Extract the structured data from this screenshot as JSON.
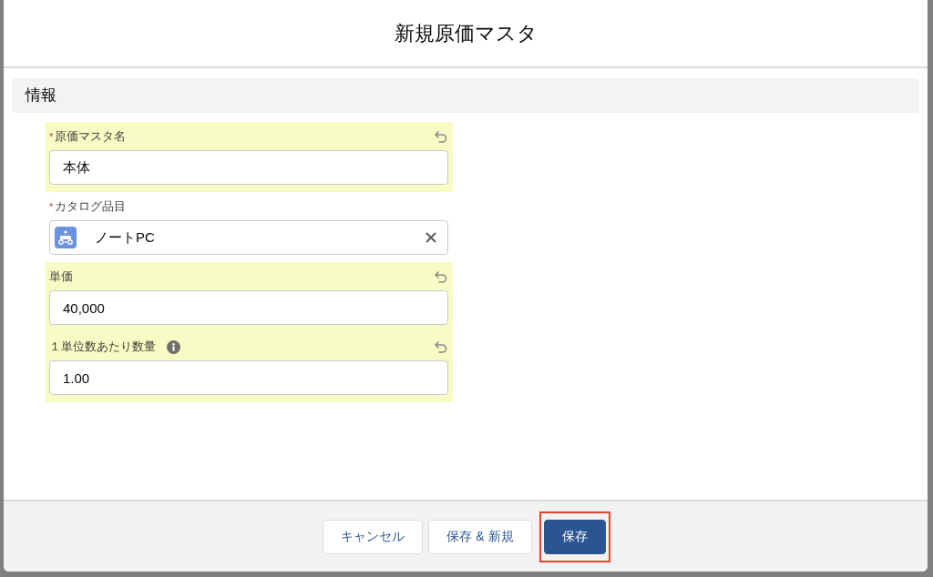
{
  "modal": {
    "title": "新規原価マスタ"
  },
  "section": {
    "title": "情報"
  },
  "fields": [
    {
      "kind": "text",
      "label": "原価マスタ名",
      "required": true,
      "changed": true,
      "help": false,
      "value": "本体"
    },
    {
      "kind": "lookup",
      "label": "カタログ品目",
      "required": true,
      "changed": false,
      "help": false,
      "value": "ノートPC"
    },
    {
      "kind": "text",
      "label": "単価",
      "required": false,
      "changed": true,
      "help": false,
      "value": "40,000"
    },
    {
      "kind": "text",
      "label": "１単位数あたり数量",
      "required": false,
      "changed": true,
      "help": true,
      "value": "1.00"
    }
  ],
  "required_mark": "*",
  "buttons": [
    {
      "label": "キャンセル",
      "kind": "neutral",
      "highlighted": false
    },
    {
      "label": "保存 & 新規",
      "kind": "neutral",
      "highlighted": false
    },
    {
      "label": "保存",
      "kind": "brand",
      "highlighted": true
    }
  ]
}
